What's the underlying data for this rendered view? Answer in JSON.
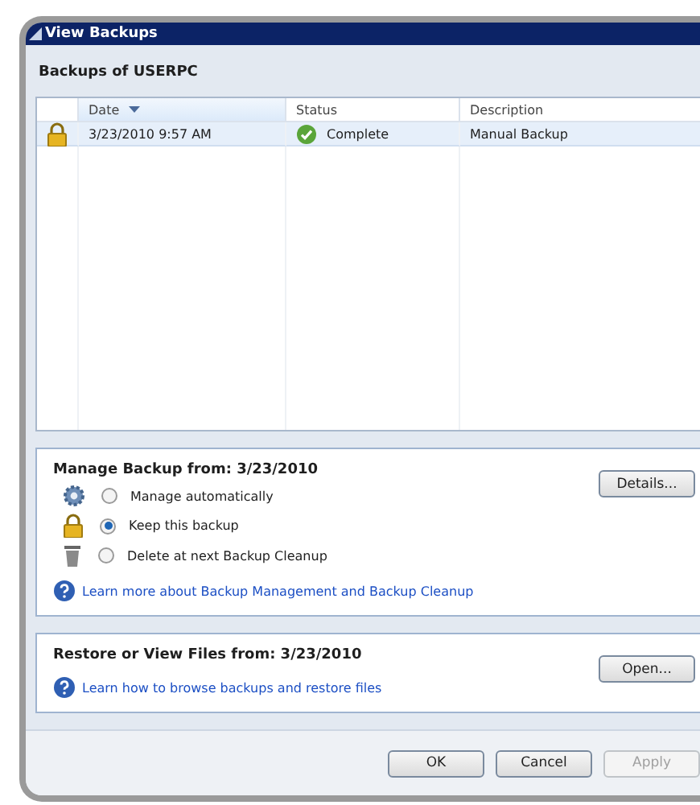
{
  "window": {
    "title": "View Backups"
  },
  "heading": "Backups of USERPC",
  "table": {
    "columns": [
      {
        "label": "Date",
        "sorted": true
      },
      {
        "label": "Status",
        "sorted": false
      },
      {
        "label": "Description",
        "sorted": false
      }
    ],
    "rows": [
      {
        "locked": true,
        "selected": true,
        "date": "3/23/2010 9:57 AM",
        "status": "Complete",
        "description": "Manual Backup"
      }
    ]
  },
  "manage": {
    "title": "Manage Backup from: 3/23/2010",
    "button": "Details...",
    "options": [
      {
        "kind": "gear",
        "label": "Manage automatically",
        "selected": false
      },
      {
        "kind": "lock",
        "label": "Keep this backup",
        "selected": true
      },
      {
        "kind": "trash",
        "label": "Delete at next Backup Cleanup",
        "selected": false
      }
    ],
    "link": "Learn more about Backup Management and Backup Cleanup"
  },
  "restore": {
    "title": "Restore or View Files from: 3/23/2010",
    "button": "Open...",
    "link": "Learn how to browse backups and restore files"
  },
  "buttons": [
    {
      "label": "OK",
      "disabled": false
    },
    {
      "label": "Cancel",
      "disabled": false
    },
    {
      "label": "Apply",
      "disabled": true
    }
  ]
}
